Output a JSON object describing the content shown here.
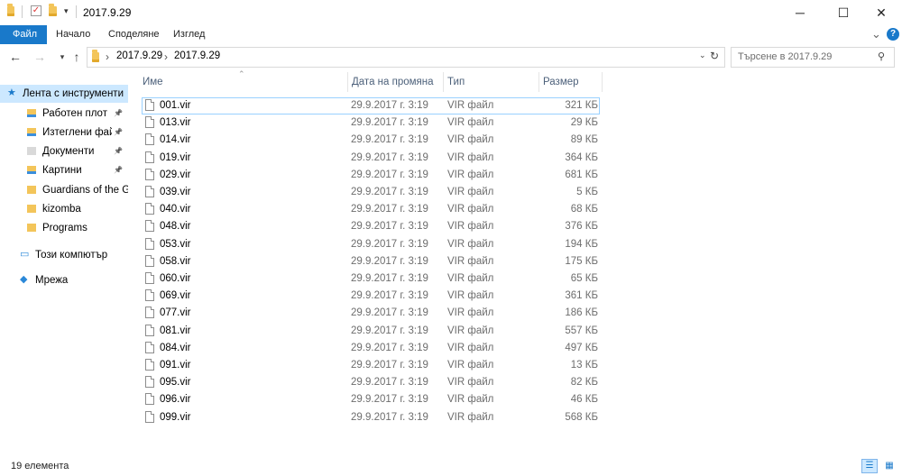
{
  "window": {
    "title": "2017.9.29",
    "minimize_glyph": "─",
    "maximize_glyph": "☐",
    "close_glyph": "✕"
  },
  "ribbon": {
    "tabs": [
      {
        "label": "Файл",
        "active": true
      },
      {
        "label": "Начало",
        "active": false
      },
      {
        "label": "Споделяне",
        "active": false
      },
      {
        "label": "Изглед",
        "active": false
      }
    ],
    "expand_glyph": "⌄",
    "help_glyph": "?"
  },
  "address": {
    "breadcrumb": [
      "2017.9.29",
      "2017.9.29"
    ],
    "separator": "›",
    "search_placeholder": "Търсене в 2017.9.29"
  },
  "nav": {
    "items": [
      {
        "label": "Лента с инструменти",
        "icon": "star-icon",
        "pinned": false,
        "selected": true
      },
      {
        "label": "Работен плот",
        "icon": "desktop-folder-icon",
        "pinned": true,
        "selected": false
      },
      {
        "label": "Изтеглени файлове",
        "icon": "download-folder-icon",
        "pinned": true,
        "selected": false
      },
      {
        "label": "Документи",
        "icon": "documents-icon",
        "pinned": true,
        "selected": false
      },
      {
        "label": "Картини",
        "icon": "pictures-icon",
        "pinned": true,
        "selected": false
      },
      {
        "label": "Guardians of the Galaxy",
        "icon": "folder-icon",
        "pinned": false,
        "selected": false
      },
      {
        "label": "kizomba",
        "icon": "folder-icon",
        "pinned": false,
        "selected": false
      },
      {
        "label": "Programs",
        "icon": "folder-icon",
        "pinned": false,
        "selected": false
      },
      {
        "label": "Този компютър",
        "icon": "computer-icon",
        "pinned": false,
        "selected": false
      },
      {
        "label": "Мрежа",
        "icon": "network-icon",
        "pinned": false,
        "selected": false
      }
    ]
  },
  "list": {
    "columns": [
      "Име",
      "Дата на промяна",
      "Тип",
      "Размер"
    ],
    "files": [
      {
        "name": "001.vir",
        "date": "29.9.2017 г. 3:19",
        "type": "VIR файл",
        "size": "321 КБ"
      },
      {
        "name": "013.vir",
        "date": "29.9.2017 г. 3:19",
        "type": "VIR файл",
        "size": "29 КБ"
      },
      {
        "name": "014.vir",
        "date": "29.9.2017 г. 3:19",
        "type": "VIR файл",
        "size": "89 КБ"
      },
      {
        "name": "019.vir",
        "date": "29.9.2017 г. 3:19",
        "type": "VIR файл",
        "size": "364 КБ"
      },
      {
        "name": "029.vir",
        "date": "29.9.2017 г. 3:19",
        "type": "VIR файл",
        "size": "681 КБ"
      },
      {
        "name": "039.vir",
        "date": "29.9.2017 г. 3:19",
        "type": "VIR файл",
        "size": "5 КБ"
      },
      {
        "name": "040.vir",
        "date": "29.9.2017 г. 3:19",
        "type": "VIR файл",
        "size": "68 КБ"
      },
      {
        "name": "048.vir",
        "date": "29.9.2017 г. 3:19",
        "type": "VIR файл",
        "size": "376 КБ"
      },
      {
        "name": "053.vir",
        "date": "29.9.2017 г. 3:19",
        "type": "VIR файл",
        "size": "194 КБ"
      },
      {
        "name": "058.vir",
        "date": "29.9.2017 г. 3:19",
        "type": "VIR файл",
        "size": "175 КБ"
      },
      {
        "name": "060.vir",
        "date": "29.9.2017 г. 3:19",
        "type": "VIR файл",
        "size": "65 КБ"
      },
      {
        "name": "069.vir",
        "date": "29.9.2017 г. 3:19",
        "type": "VIR файл",
        "size": "361 КБ"
      },
      {
        "name": "077.vir",
        "date": "29.9.2017 г. 3:19",
        "type": "VIR файл",
        "size": "186 КБ"
      },
      {
        "name": "081.vir",
        "date": "29.9.2017 г. 3:19",
        "type": "VIR файл",
        "size": "557 КБ"
      },
      {
        "name": "084.vir",
        "date": "29.9.2017 г. 3:19",
        "type": "VIR файл",
        "size": "497 КБ"
      },
      {
        "name": "091.vir",
        "date": "29.9.2017 г. 3:19",
        "type": "VIR файл",
        "size": "13 КБ"
      },
      {
        "name": "095.vir",
        "date": "29.9.2017 г. 3:19",
        "type": "VIR файл",
        "size": "82 КБ"
      },
      {
        "name": "096.vir",
        "date": "29.9.2017 г. 3:19",
        "type": "VIR файл",
        "size": "46 КБ"
      },
      {
        "name": "099.vir",
        "date": "29.9.2017 г. 3:19",
        "type": "VIR файл",
        "size": "568 КБ"
      }
    ]
  },
  "status": {
    "item_count": "19 елемента"
  },
  "colors": {
    "accent": "#1979ca",
    "selection": "#cce8ff",
    "folder": "#f3c55a"
  }
}
